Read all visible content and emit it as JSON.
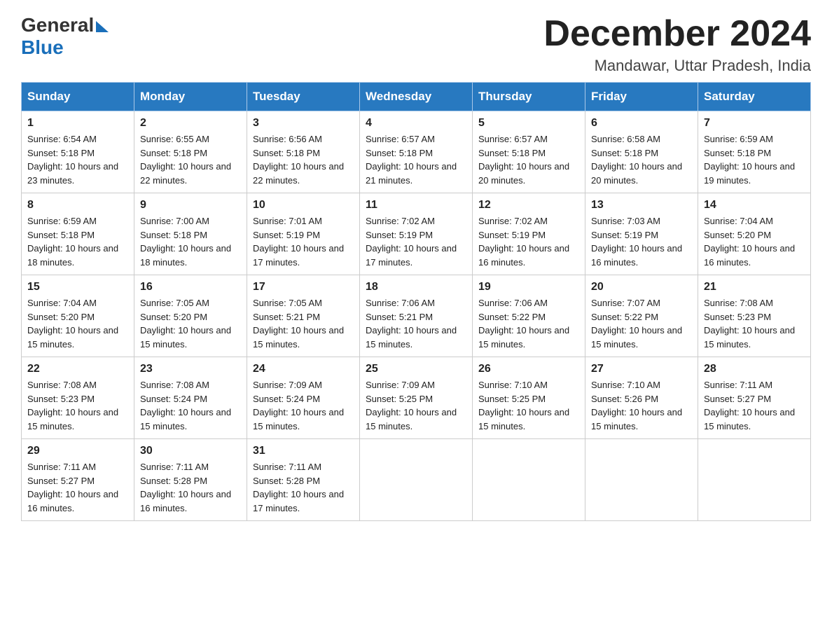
{
  "header": {
    "logo_general": "General",
    "logo_blue": "Blue",
    "month_title": "December 2024",
    "location": "Mandawar, Uttar Pradesh, India"
  },
  "days_of_week": [
    "Sunday",
    "Monday",
    "Tuesday",
    "Wednesday",
    "Thursday",
    "Friday",
    "Saturday"
  ],
  "weeks": [
    [
      {
        "day": "1",
        "sunrise": "6:54 AM",
        "sunset": "5:18 PM",
        "daylight": "10 hours and 23 minutes."
      },
      {
        "day": "2",
        "sunrise": "6:55 AM",
        "sunset": "5:18 PM",
        "daylight": "10 hours and 22 minutes."
      },
      {
        "day": "3",
        "sunrise": "6:56 AM",
        "sunset": "5:18 PM",
        "daylight": "10 hours and 22 minutes."
      },
      {
        "day": "4",
        "sunrise": "6:57 AM",
        "sunset": "5:18 PM",
        "daylight": "10 hours and 21 minutes."
      },
      {
        "day": "5",
        "sunrise": "6:57 AM",
        "sunset": "5:18 PM",
        "daylight": "10 hours and 20 minutes."
      },
      {
        "day": "6",
        "sunrise": "6:58 AM",
        "sunset": "5:18 PM",
        "daylight": "10 hours and 20 minutes."
      },
      {
        "day": "7",
        "sunrise": "6:59 AM",
        "sunset": "5:18 PM",
        "daylight": "10 hours and 19 minutes."
      }
    ],
    [
      {
        "day": "8",
        "sunrise": "6:59 AM",
        "sunset": "5:18 PM",
        "daylight": "10 hours and 18 minutes."
      },
      {
        "day": "9",
        "sunrise": "7:00 AM",
        "sunset": "5:18 PM",
        "daylight": "10 hours and 18 minutes."
      },
      {
        "day": "10",
        "sunrise": "7:01 AM",
        "sunset": "5:19 PM",
        "daylight": "10 hours and 17 minutes."
      },
      {
        "day": "11",
        "sunrise": "7:02 AM",
        "sunset": "5:19 PM",
        "daylight": "10 hours and 17 minutes."
      },
      {
        "day": "12",
        "sunrise": "7:02 AM",
        "sunset": "5:19 PM",
        "daylight": "10 hours and 16 minutes."
      },
      {
        "day": "13",
        "sunrise": "7:03 AM",
        "sunset": "5:19 PM",
        "daylight": "10 hours and 16 minutes."
      },
      {
        "day": "14",
        "sunrise": "7:04 AM",
        "sunset": "5:20 PM",
        "daylight": "10 hours and 16 minutes."
      }
    ],
    [
      {
        "day": "15",
        "sunrise": "7:04 AM",
        "sunset": "5:20 PM",
        "daylight": "10 hours and 15 minutes."
      },
      {
        "day": "16",
        "sunrise": "7:05 AM",
        "sunset": "5:20 PM",
        "daylight": "10 hours and 15 minutes."
      },
      {
        "day": "17",
        "sunrise": "7:05 AM",
        "sunset": "5:21 PM",
        "daylight": "10 hours and 15 minutes."
      },
      {
        "day": "18",
        "sunrise": "7:06 AM",
        "sunset": "5:21 PM",
        "daylight": "10 hours and 15 minutes."
      },
      {
        "day": "19",
        "sunrise": "7:06 AM",
        "sunset": "5:22 PM",
        "daylight": "10 hours and 15 minutes."
      },
      {
        "day": "20",
        "sunrise": "7:07 AM",
        "sunset": "5:22 PM",
        "daylight": "10 hours and 15 minutes."
      },
      {
        "day": "21",
        "sunrise": "7:08 AM",
        "sunset": "5:23 PM",
        "daylight": "10 hours and 15 minutes."
      }
    ],
    [
      {
        "day": "22",
        "sunrise": "7:08 AM",
        "sunset": "5:23 PM",
        "daylight": "10 hours and 15 minutes."
      },
      {
        "day": "23",
        "sunrise": "7:08 AM",
        "sunset": "5:24 PM",
        "daylight": "10 hours and 15 minutes."
      },
      {
        "day": "24",
        "sunrise": "7:09 AM",
        "sunset": "5:24 PM",
        "daylight": "10 hours and 15 minutes."
      },
      {
        "day": "25",
        "sunrise": "7:09 AM",
        "sunset": "5:25 PM",
        "daylight": "10 hours and 15 minutes."
      },
      {
        "day": "26",
        "sunrise": "7:10 AM",
        "sunset": "5:25 PM",
        "daylight": "10 hours and 15 minutes."
      },
      {
        "day": "27",
        "sunrise": "7:10 AM",
        "sunset": "5:26 PM",
        "daylight": "10 hours and 15 minutes."
      },
      {
        "day": "28",
        "sunrise": "7:11 AM",
        "sunset": "5:27 PM",
        "daylight": "10 hours and 15 minutes."
      }
    ],
    [
      {
        "day": "29",
        "sunrise": "7:11 AM",
        "sunset": "5:27 PM",
        "daylight": "10 hours and 16 minutes."
      },
      {
        "day": "30",
        "sunrise": "7:11 AM",
        "sunset": "5:28 PM",
        "daylight": "10 hours and 16 minutes."
      },
      {
        "day": "31",
        "sunrise": "7:11 AM",
        "sunset": "5:28 PM",
        "daylight": "10 hours and 17 minutes."
      },
      null,
      null,
      null,
      null
    ]
  ],
  "labels": {
    "sunrise": "Sunrise: ",
    "sunset": "Sunset: ",
    "daylight": "Daylight: "
  }
}
